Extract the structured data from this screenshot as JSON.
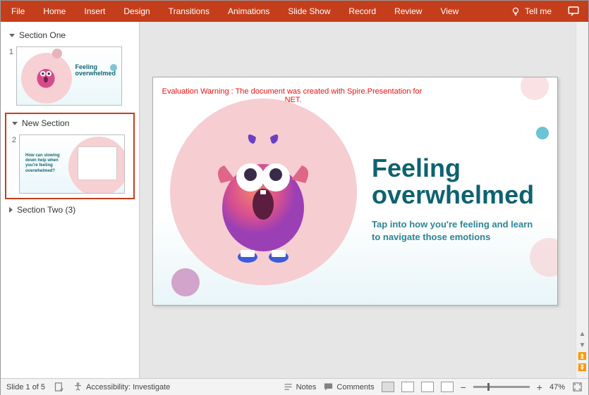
{
  "ribbon": {
    "tabs": [
      "File",
      "Home",
      "Insert",
      "Design",
      "Transitions",
      "Animations",
      "Slide Show",
      "Record",
      "Review",
      "View"
    ],
    "tellme": "Tell me"
  },
  "sidebar": {
    "section1": {
      "label": "Section One"
    },
    "slide1": {
      "num": "1",
      "title": "Feeling\noverwhelmed",
      "sub": "Tap into how you're feeling and learn to navigate those emotions"
    },
    "newSection": {
      "label": "New Section"
    },
    "slide2": {
      "num": "2",
      "text": "How can slowing down help when you're feeling overwhelmed?"
    },
    "section2": {
      "label": "Section Two (3)"
    }
  },
  "slide": {
    "warning": "Evaluation Warning : The document was created with  Spire.Presentation for .NET.",
    "title": "Feeling overwhelmed",
    "subtitle": "Tap into how you're feeling and learn to navigate those emotions"
  },
  "status": {
    "slideCount": "Slide 1 of 5",
    "accessibility": "Accessibility: Investigate",
    "notes": "Notes",
    "comments": "Comments",
    "zoom": "47%"
  }
}
